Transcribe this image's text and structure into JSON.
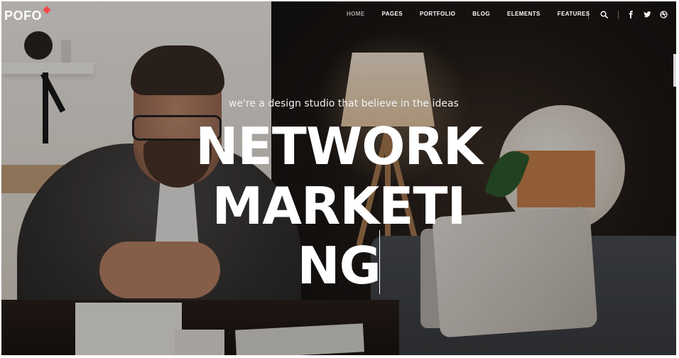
{
  "header": {
    "logo": "POFO",
    "nav": [
      {
        "label": "HOME",
        "active": true
      },
      {
        "label": "PAGES",
        "active": false
      },
      {
        "label": "PORTFOLIO",
        "active": false
      },
      {
        "label": "BLOG",
        "active": false
      },
      {
        "label": "ELEMENTS",
        "active": false
      },
      {
        "label": "FEATURES",
        "active": false
      }
    ],
    "icons": [
      "search-icon",
      "facebook-icon",
      "twitter-icon",
      "dribbble-icon"
    ]
  },
  "hero": {
    "tagline": "we're a design studio that believe in the ideas",
    "headline_lines": [
      "NETWORK",
      "MARKETI",
      "NG"
    ]
  },
  "colors": {
    "accent": "#f24a4a",
    "nav_active": "#a9a9a9",
    "text": "#ffffff"
  }
}
